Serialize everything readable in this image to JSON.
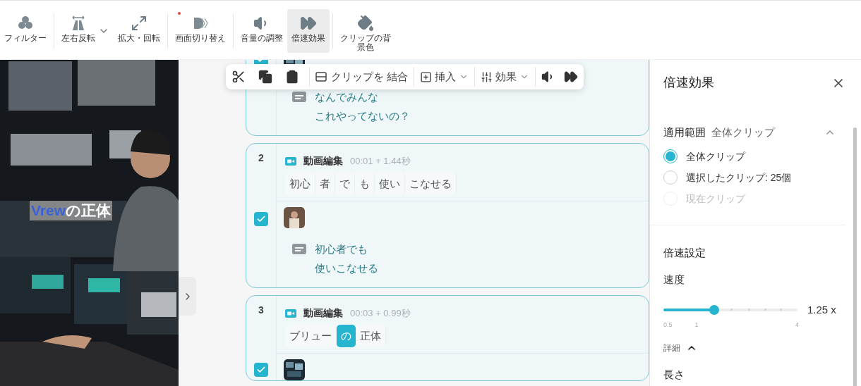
{
  "toolbar": {
    "items": [
      {
        "label": "フィルター",
        "selected": false,
        "caret": false,
        "dot": false
      },
      {
        "label": "左右反転",
        "selected": false,
        "caret": true,
        "dot": false
      },
      {
        "label": "拡大・回転",
        "selected": false,
        "caret": false,
        "dot": false
      },
      {
        "label": "画面切り替え",
        "selected": false,
        "caret": false,
        "dot": true
      },
      {
        "label": "音量の調整",
        "selected": false,
        "caret": false,
        "dot": false
      },
      {
        "label": "倍速効果",
        "selected": true,
        "caret": false,
        "dot": false
      },
      {
        "label": "クリップの背景色",
        "selected": false,
        "caret": false,
        "dot": false
      }
    ]
  },
  "preview": {
    "caption_highlight": "Vrew",
    "caption_rest": "の正体"
  },
  "floating_toolbar": {
    "merge": "クリップを 結合",
    "insert": "挿入",
    "effects": "効果"
  },
  "clips": [
    {
      "checked": true,
      "subtitle": [
        "なんでみんな",
        "これやってないの？"
      ]
    },
    {
      "number": "2",
      "type": "動画編集",
      "time": "00:01 + 1.44秒",
      "checked": true,
      "words": [
        {
          "text": "初心",
          "selected": false
        },
        {
          "text": "者",
          "selected": false
        },
        {
          "text": "で",
          "selected": false
        },
        {
          "text": "も",
          "selected": false
        },
        {
          "text": "使い",
          "selected": false
        },
        {
          "text": "こなせる",
          "selected": false
        }
      ],
      "subtitle": [
        "初心者でも",
        "使いこなせる"
      ]
    },
    {
      "number": "3",
      "type": "動画編集",
      "time": "00:03 + 0.99秒",
      "checked": true,
      "words": [
        {
          "text": "ブリュー",
          "selected": false
        },
        {
          "text": "の",
          "selected": true
        },
        {
          "text": "正体",
          "selected": false
        }
      ]
    }
  ],
  "panel": {
    "title": "倍速効果",
    "scope_label": "適用範囲",
    "scope_value": "全体クリップ",
    "options": [
      {
        "label": "全体クリップ",
        "selected": true,
        "disabled": false
      },
      {
        "label": "選択したクリップ: 25個",
        "selected": false,
        "disabled": false
      },
      {
        "label": "現在クリップ",
        "selected": false,
        "disabled": true
      }
    ],
    "speed_section": "倍速設定",
    "speed_label": "速度",
    "speed": {
      "level": 0.38,
      "reading": "1.25 x",
      "marks": [
        "0.5",
        "1",
        "4"
      ]
    },
    "details": "詳細",
    "length_label": "長さ"
  }
}
